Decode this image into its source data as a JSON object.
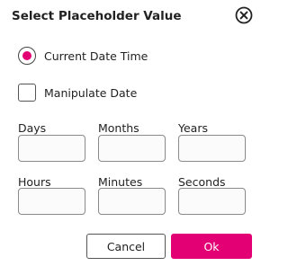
{
  "dialog": {
    "title": "Select Placeholder Value",
    "close_icon": "close-circle-icon"
  },
  "options": {
    "current_date_time": {
      "label": "Current Date Time",
      "selected": true
    },
    "manipulate_date": {
      "label": "Manipulate Date",
      "checked": false
    }
  },
  "fields": {
    "days": {
      "label": "Days",
      "value": ""
    },
    "months": {
      "label": "Months",
      "value": ""
    },
    "years": {
      "label": "Years",
      "value": ""
    },
    "hours": {
      "label": "Hours",
      "value": ""
    },
    "minutes": {
      "label": "Minutes",
      "value": ""
    },
    "seconds": {
      "label": "Seconds",
      "value": ""
    }
  },
  "buttons": {
    "cancel": "Cancel",
    "ok": "Ok"
  },
  "colors": {
    "accent": "#e20074",
    "text": "#222222",
    "border": "#8a8a8a"
  }
}
